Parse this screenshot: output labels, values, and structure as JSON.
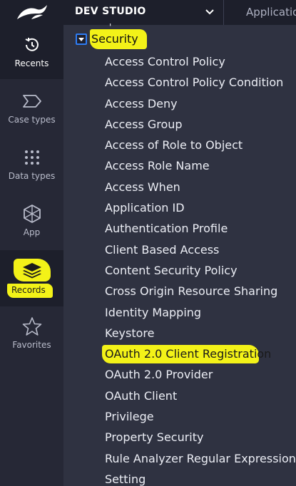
{
  "studio": {
    "title": "DEV STUDIO",
    "app_label": "Applicatio"
  },
  "rail": {
    "items": [
      {
        "label": "Recents",
        "icon": "history-icon"
      },
      {
        "label": "Case types",
        "icon": "case-types-icon"
      },
      {
        "label": "Data types",
        "icon": "data-types-icon"
      },
      {
        "label": "App",
        "icon": "cube-icon"
      },
      {
        "label": "Records",
        "icon": "layers-icon"
      },
      {
        "label": "Favorites",
        "icon": "star-icon"
      }
    ]
  },
  "tree": {
    "category": "Security",
    "items": [
      "Access Control Policy",
      "Access Control Policy Condition",
      "Access Deny",
      "Access Group",
      "Access of Role to Object",
      "Access Role Name",
      "Access When",
      "Application ID",
      "Authentication Profile",
      "Client Based Access",
      "Content Security Policy",
      "Cross Origin Resource Sharing",
      "Identity Mapping",
      "Keystore",
      "OAuth 2.0 Client Registration",
      "OAuth 2.0 Provider",
      "OAuth Client",
      "Privilege",
      "Property Security",
      "Rule Analyzer Regular Expression",
      "Setting"
    ],
    "highlighted_item": "OAuth 2.0 Client Registration"
  },
  "colors": {
    "highlight": "#f3f218",
    "rail_bg": "#262836",
    "panel_bg": "#2f3241",
    "toggle_border": "#2e7df5"
  }
}
